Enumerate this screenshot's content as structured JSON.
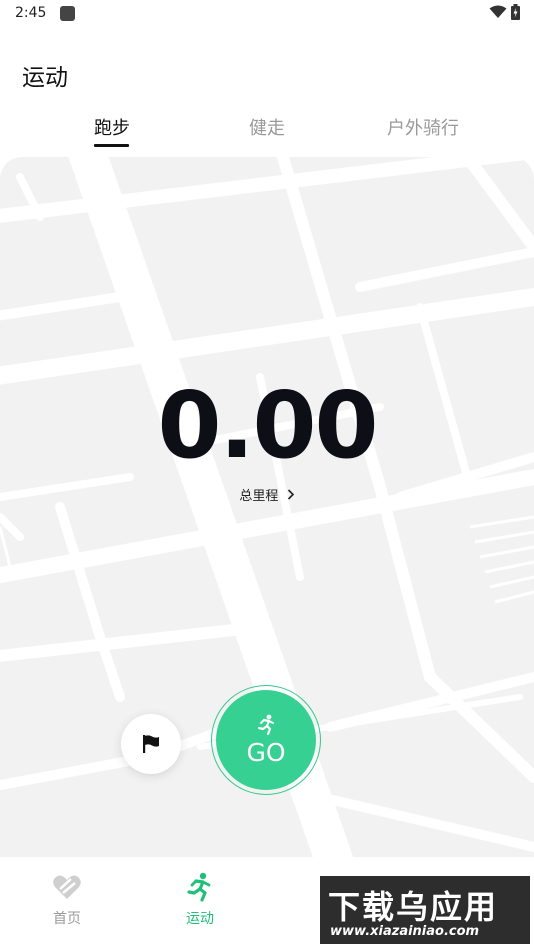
{
  "status_bar": {
    "time": "2:45"
  },
  "page": {
    "title": "运动"
  },
  "tabs": [
    {
      "label": "跑步",
      "active": true
    },
    {
      "label": "健走",
      "active": false
    },
    {
      "label": "户外骑行",
      "active": false
    }
  ],
  "stats": {
    "distance": "0.00",
    "distance_label": "总里程"
  },
  "actions": {
    "go_label": "GO"
  },
  "bottom_nav": [
    {
      "label": "首页",
      "icon": "home-heart-icon",
      "active": false
    },
    {
      "label": "运动",
      "icon": "running-icon",
      "active": true
    }
  ],
  "watermark": {
    "title": "下载乌应用",
    "url": "www.xiazainiao.com"
  },
  "colors": {
    "accent": "#36d192",
    "accent_text": "#20c07a",
    "map_bg": "#f2f2f2"
  }
}
